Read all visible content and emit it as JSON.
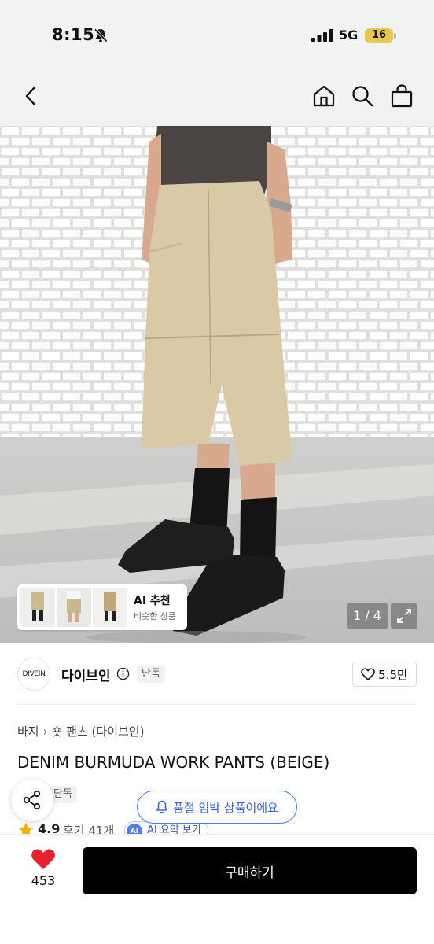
{
  "status_bar": {
    "time": "8:15",
    "network": "5G",
    "battery": "16",
    "icons": [
      "bell-off-icon",
      "signal-icon",
      "battery-icon"
    ]
  },
  "nav": {
    "icons": [
      "back-chevron-icon",
      "home-icon",
      "search-icon",
      "shopping-bag-icon"
    ]
  },
  "gallery": {
    "pager": "1 / 4",
    "ai_recommend": {
      "title": "AI 추천",
      "subtitle": "비슷한 상품"
    }
  },
  "brand": {
    "logo_text": "DIVEIN",
    "name": "다이브인",
    "badge": "단독",
    "likes": "5.5만"
  },
  "breadcrumb": {
    "category": "바지",
    "subcategory": "숏 팬츠 (다이브인)"
  },
  "product": {
    "title": "DENIM BURMUDA WORK PANTS (BEIGE)",
    "badge": "단독",
    "rating": "4.9",
    "reviews": "후기 41개",
    "ai_summary": "AI 요약 보기",
    "ai_badge": "AI"
  },
  "toast": {
    "text": "품절 임박 상품이에요"
  },
  "bottom": {
    "wish_count": "453",
    "buy_label": "구매하기"
  },
  "colors": {
    "accent_blue": "#2f66e6",
    "heart_red": "#e8202e",
    "buy_bg": "#000000"
  }
}
